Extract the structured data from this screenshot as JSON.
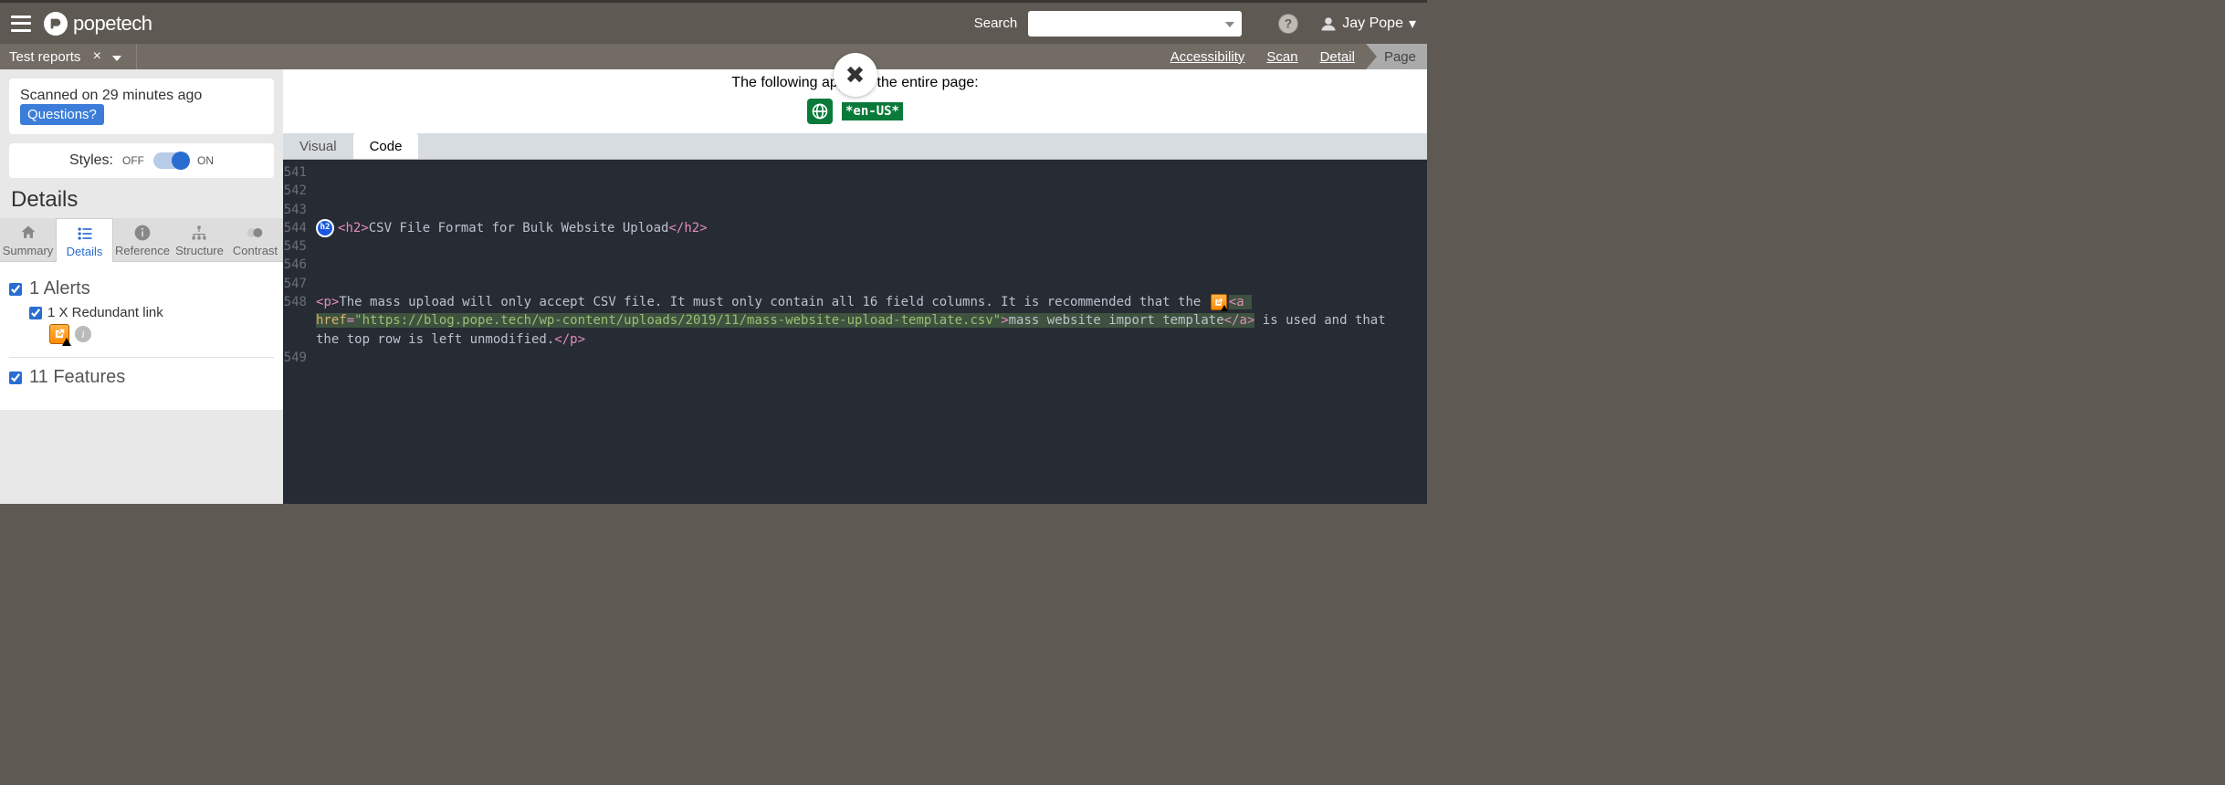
{
  "brand": {
    "name": "popetech"
  },
  "search": {
    "label": "Search",
    "value": ""
  },
  "user": {
    "name": "Jay Pope"
  },
  "tab": {
    "title": "Test reports"
  },
  "breadcrumbs": {
    "items": [
      "Accessibility",
      "Scan",
      "Detail",
      "Page"
    ]
  },
  "left": {
    "scanned": "Scanned on 29 minutes ago",
    "questions": "Questions?",
    "styles_label": "Styles:",
    "off": "OFF",
    "on": "ON",
    "details_heading": "Details",
    "tabs": {
      "summary": "Summary",
      "details": "Details",
      "reference": "Reference",
      "structure": "Structure",
      "contrast": "Contrast"
    },
    "groups": {
      "alerts": {
        "count": "1",
        "label": "Alerts"
      },
      "alerts_sub": {
        "count_label": "1 X Redundant link"
      },
      "features": {
        "count": "11",
        "label": "Features"
      }
    }
  },
  "right": {
    "apply_msg": "The following apply to the entire page:",
    "lang": "*en-US*",
    "tabs": {
      "visual": "Visual",
      "code": "Code"
    },
    "code": {
      "lines": [
        "541",
        "542",
        "543",
        "544",
        "545",
        "546",
        "547",
        "548",
        "549"
      ],
      "h2_text": "CSV File Format for Bulk Website Upload",
      "p_pre": "The mass upload will only accept CSV file. It must only contain all 16 field columns. It is recommended that the ",
      "a_href": "https://blog.pope.tech/wp-content/uploads/2019/11/mass-website-upload-template.csv",
      "a_text": "mass website import template",
      "p_post": " is used and that the top row is left unmodified."
    }
  }
}
